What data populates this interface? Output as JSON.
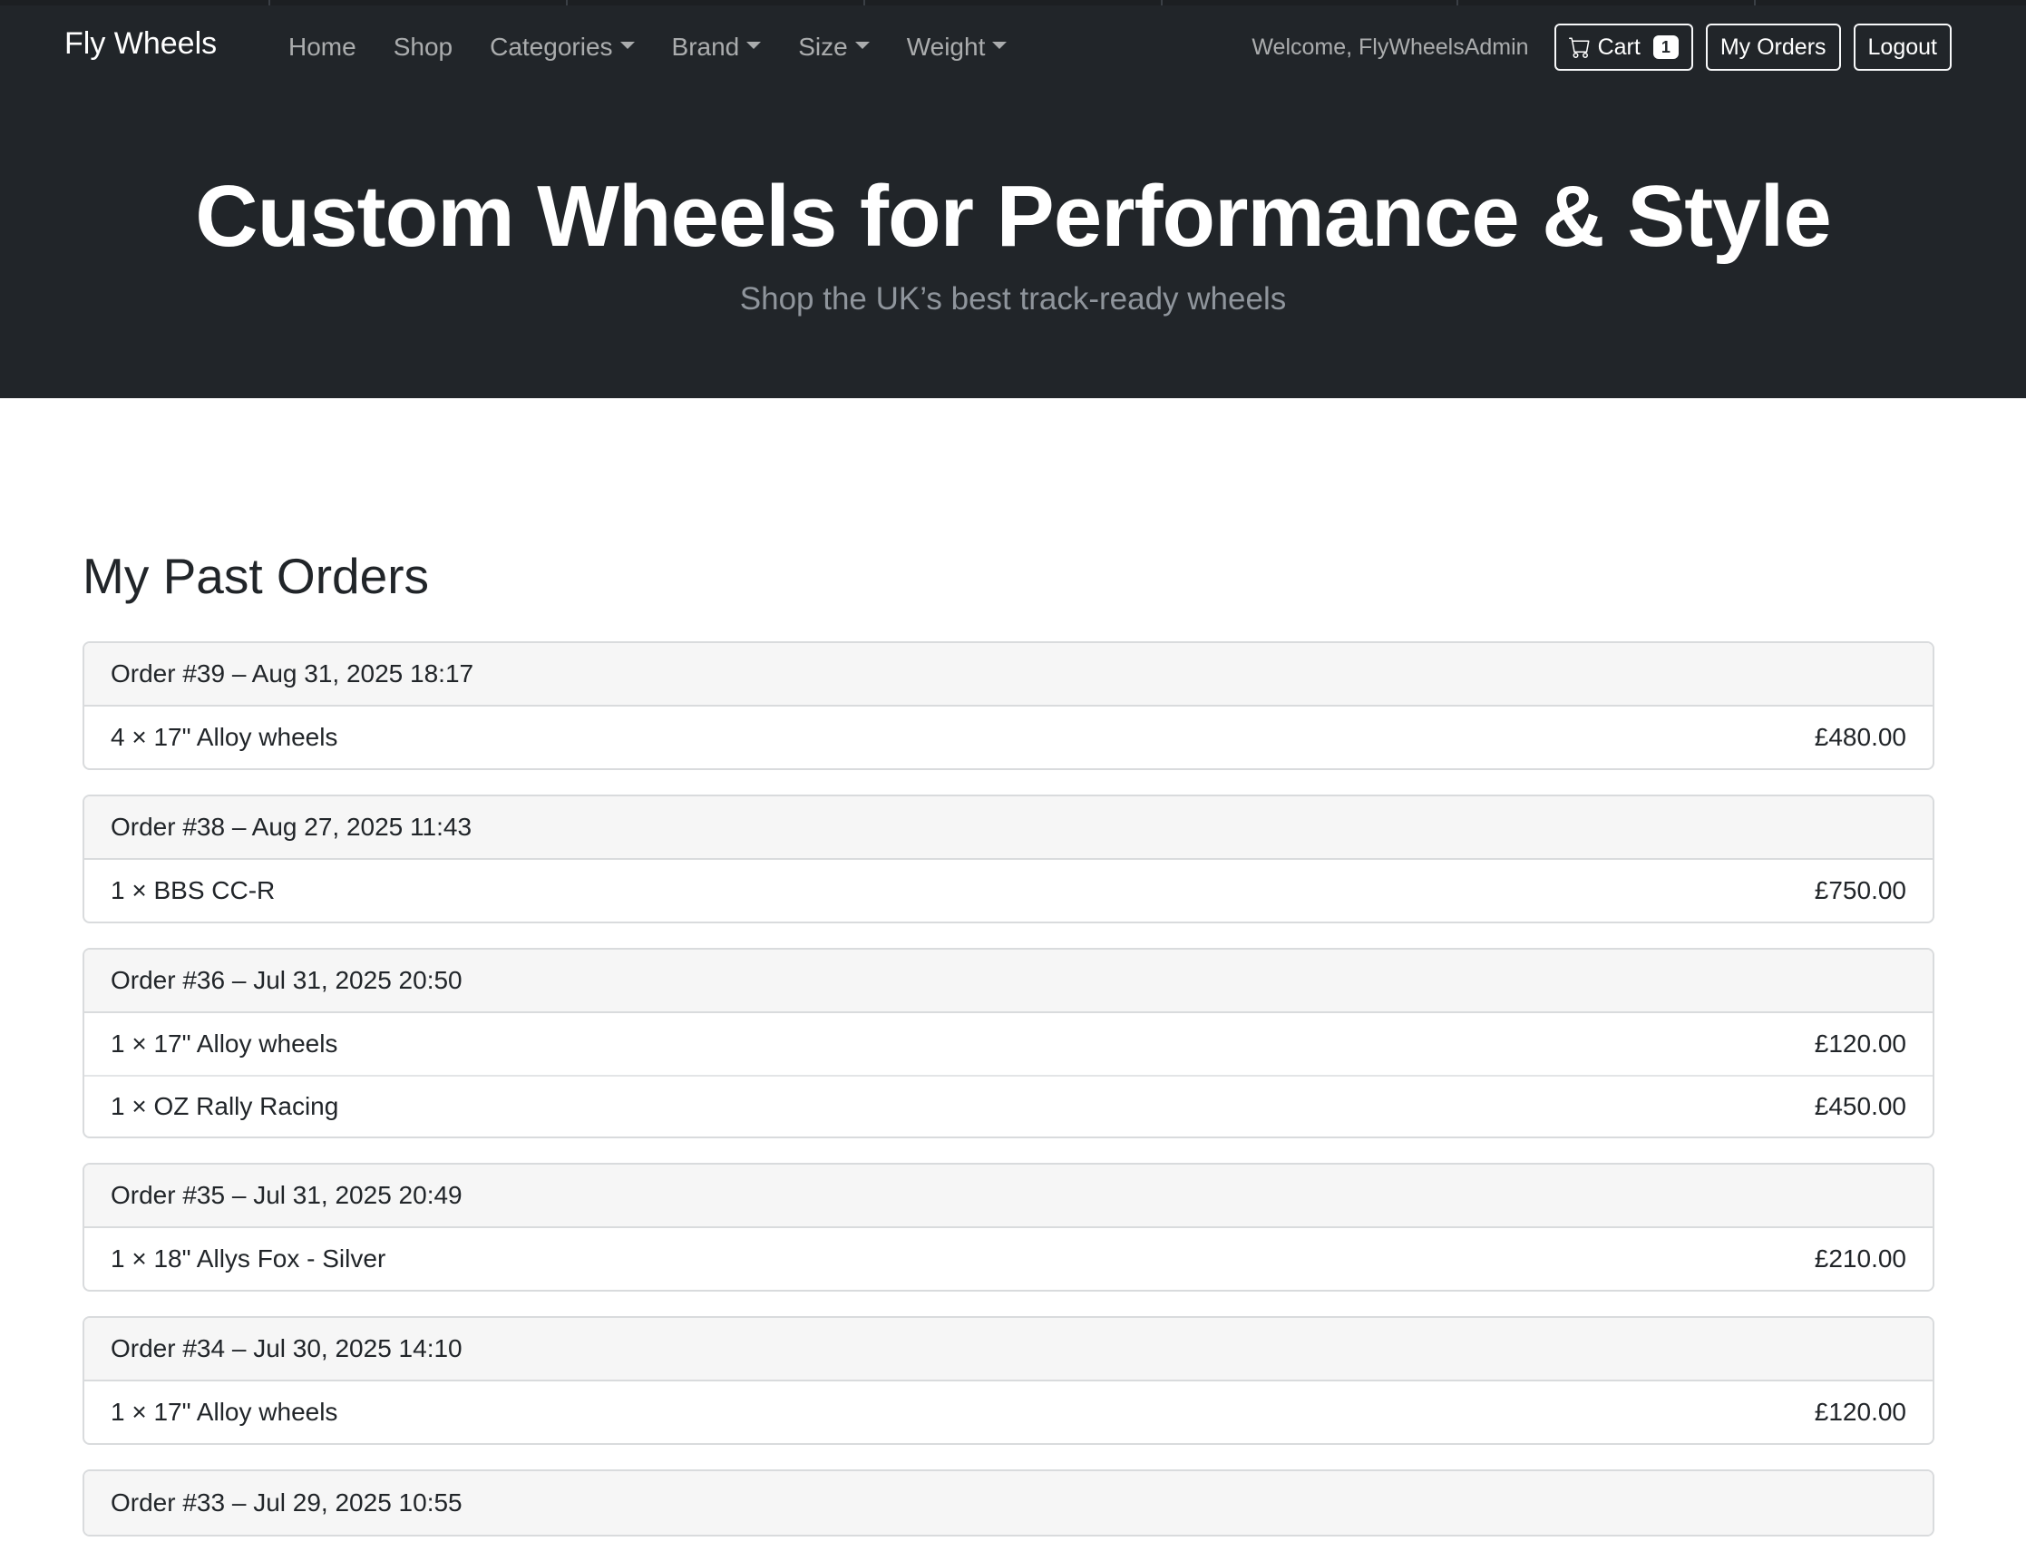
{
  "navbar": {
    "brand": "Fly Wheels",
    "links": [
      {
        "label": "Home",
        "dropdown": false
      },
      {
        "label": "Shop",
        "dropdown": false
      },
      {
        "label": "Categories",
        "dropdown": true
      },
      {
        "label": "Brand",
        "dropdown": true
      },
      {
        "label": "Size",
        "dropdown": true
      },
      {
        "label": "Weight",
        "dropdown": true
      }
    ],
    "welcome": "Welcome, FlyWheelsAdmin",
    "cart_label": "Cart",
    "cart_count": "1",
    "my_orders_label": "My Orders",
    "logout_label": "Logout"
  },
  "hero": {
    "title": "Custom Wheels for Performance & Style",
    "subtitle": "Shop the UK’s best track-ready wheels"
  },
  "page": {
    "heading": "My Past Orders"
  },
  "orders": [
    {
      "header": "Order #39 – Aug 31, 2025 18:17",
      "items": [
        {
          "desc": "4 × 17\" Alloy wheels",
          "price": "£480.00"
        }
      ]
    },
    {
      "header": "Order #38 – Aug 27, 2025 11:43",
      "items": [
        {
          "desc": "1 × BBS CC-R",
          "price": "£750.00"
        }
      ]
    },
    {
      "header": "Order #36 – Jul 31, 2025 20:50",
      "items": [
        {
          "desc": "1 × 17\" Alloy wheels",
          "price": "£120.00"
        },
        {
          "desc": "1 × OZ Rally Racing",
          "price": "£450.00"
        }
      ]
    },
    {
      "header": "Order #35 – Jul 31, 2025 20:49",
      "items": [
        {
          "desc": "1 × 18\" Allys Fox - Silver",
          "price": "£210.00"
        }
      ]
    },
    {
      "header": "Order #34 – Jul 30, 2025 14:10",
      "items": [
        {
          "desc": "1 × 17\" Alloy wheels",
          "price": "£120.00"
        }
      ]
    },
    {
      "header": "Order #33 – Jul 29, 2025 10:55",
      "items": []
    }
  ]
}
